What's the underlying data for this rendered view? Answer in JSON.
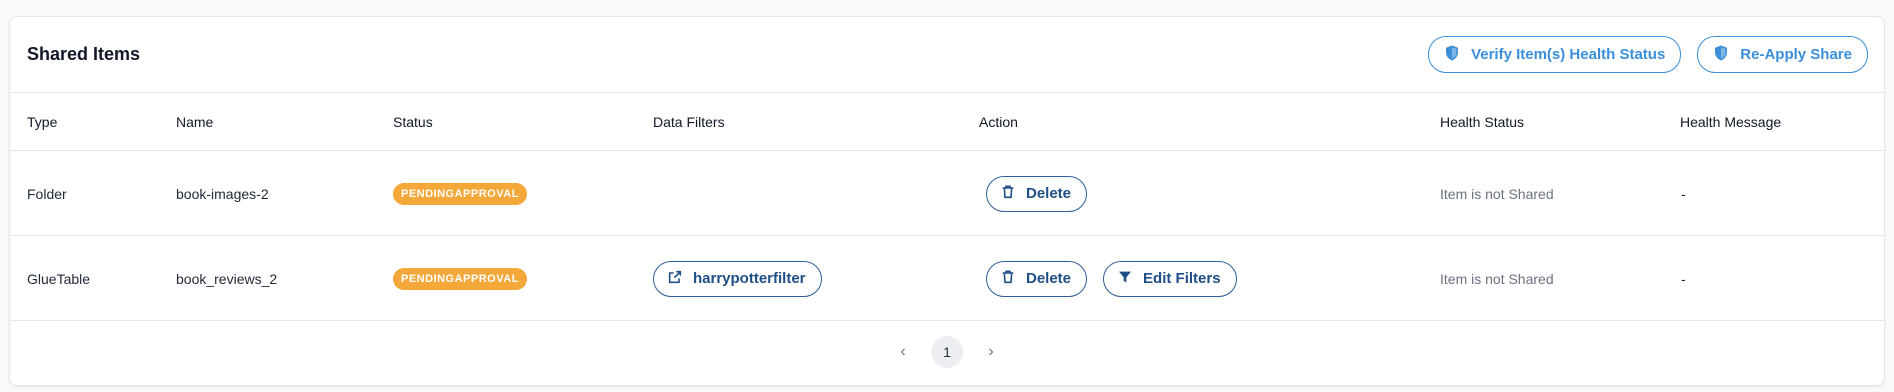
{
  "header": {
    "title": "Shared Items",
    "verify_label": "Verify Item(s) Health Status",
    "reapply_label": "Re-Apply Share"
  },
  "columns": {
    "type": "Type",
    "name": "Name",
    "status": "Status",
    "data_filters": "Data Filters",
    "action": "Action",
    "health_status": "Health Status",
    "health_message": "Health Message"
  },
  "rows": [
    {
      "type": "Folder",
      "name": "book-images-2",
      "status": "PENDINGAPPROVAL",
      "data_filter": "",
      "delete_label": "Delete",
      "health_status": "Item is not Shared",
      "health_message": "-"
    },
    {
      "type": "GlueTable",
      "name": "book_reviews_2",
      "status": "PENDINGAPPROVAL",
      "data_filter": "harrypotterfilter",
      "delete_label": "Delete",
      "edit_filters_label": "Edit Filters",
      "health_status": "Item is not Shared",
      "health_message": "-"
    }
  ],
  "pagination": {
    "current_page": "1",
    "prev": "‹",
    "next": "›"
  },
  "colors": {
    "accent_blue": "#3b8fd9",
    "dark_blue": "#1f4f86",
    "badge_orange": "#f4a83a"
  },
  "icons": {
    "verify": "shield-icon",
    "reapply": "shield-icon",
    "delete": "trash-icon",
    "filter_link": "external-link-icon",
    "edit_filters": "filter-icon"
  }
}
